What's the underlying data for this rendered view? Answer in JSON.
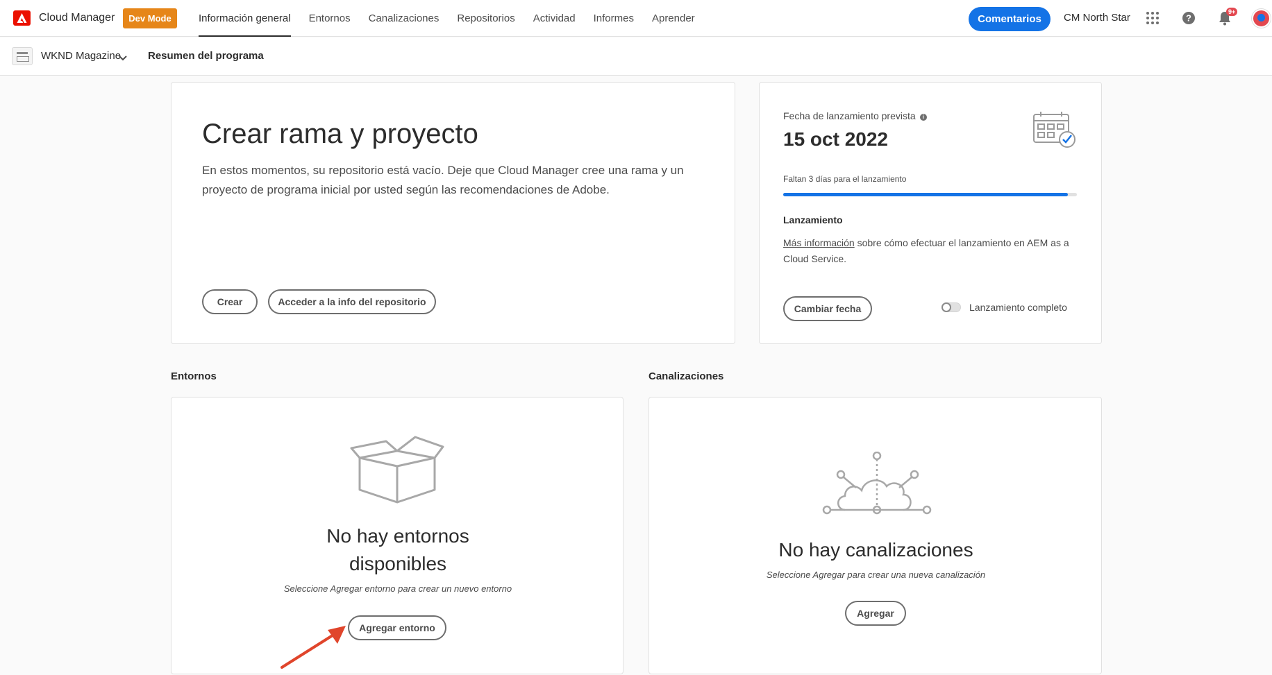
{
  "header": {
    "app_title": "Cloud Manager",
    "dev_mode": "Dev Mode",
    "nav": [
      {
        "label": "Información general"
      },
      {
        "label": "Entornos"
      },
      {
        "label": "Canalizaciones"
      },
      {
        "label": "Repositorios"
      },
      {
        "label": "Actividad"
      },
      {
        "label": "Informes"
      },
      {
        "label": "Aprender"
      }
    ],
    "active_nav": "Información general",
    "feedback": "Comentarios",
    "org": "CM North Star",
    "notifications_badge": "9+",
    "icons": [
      "adobe-logo-icon",
      "apps-grid-icon",
      "help-icon",
      "bell-icon"
    ]
  },
  "subbar": {
    "program": "WKND Magazine",
    "breadcrumb": "Resumen del programa"
  },
  "hero": {
    "title": "Crear rama y proyecto",
    "description": "En estos momentos, su repositorio está vacío. Deje que Cloud Manager cree una rama y un proyecto de programa inicial por usted según las recomendaciones de Adobe.",
    "create_button": "Crear",
    "repo_button": "Acceder a la info del repositorio"
  },
  "launch": {
    "label": "Fecha de lanzamiento prevista",
    "date": "15 oct 2022",
    "days_left": "Faltan 3 días para el lanzamiento",
    "progress": 0.97,
    "heading": "Lanzamiento",
    "link_text": "Más información",
    "text_rest": " sobre cómo efectuar el lanzamiento en AEM as a Cloud Service.",
    "change_date": "Cambiar fecha",
    "complete_label": "Lanzamiento completo",
    "complete_on": false
  },
  "environments": {
    "section_title": "Entornos",
    "empty_title_1": "No hay entornos",
    "empty_title_2": "disponibles",
    "empty_sub": "Seleccione Agregar entorno para crear un nuevo entorno",
    "add_button": "Agregar entorno"
  },
  "pipelines": {
    "section_title": "Canalizaciones",
    "empty_title": "No hay canalizaciones",
    "empty_sub": "Seleccione Agregar para crear una nueva canalización",
    "add_button": "Agregar"
  },
  "colors": {
    "accent": "#1473e6",
    "dev_mode": "#e68619",
    "adobe_red": "#eb1000",
    "annotation_arrow": "#e0452b"
  }
}
